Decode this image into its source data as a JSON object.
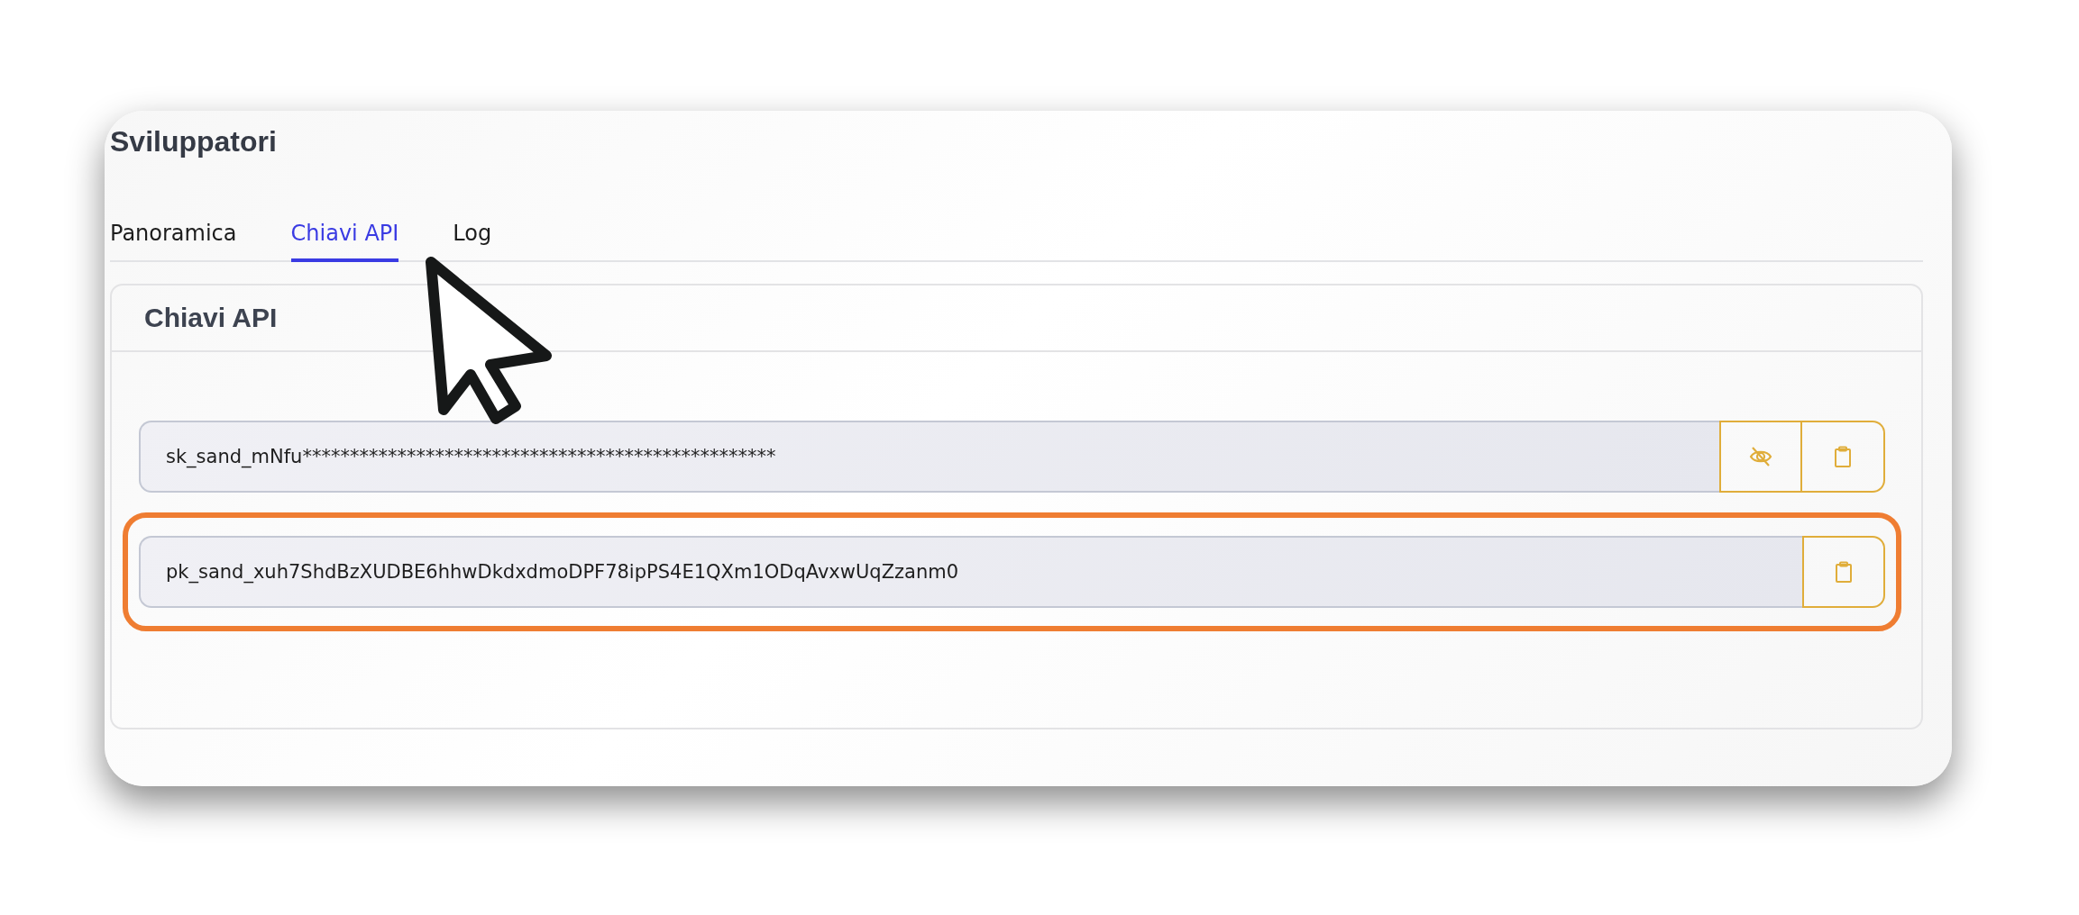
{
  "page": {
    "title": "Sviluppatori"
  },
  "tabs": [
    {
      "label": "Panoramica",
      "selected": false
    },
    {
      "label": "Chiavi API",
      "selected": true
    },
    {
      "label": "Log",
      "selected": false
    }
  ],
  "panel": {
    "title": "Chiavi API",
    "keys": [
      {
        "value": "sk_sand_mNfu**************************************************",
        "reveal_button": true,
        "highlighted": false
      },
      {
        "value": "pk_sand_xuh7ShdBzXUDBE6hhwDkdxdmoDPF78ipPS4E1QXm1ODqAvxwUqZzanm0",
        "reveal_button": false,
        "highlighted": true
      }
    ]
  },
  "cursor": {
    "visible": true
  }
}
